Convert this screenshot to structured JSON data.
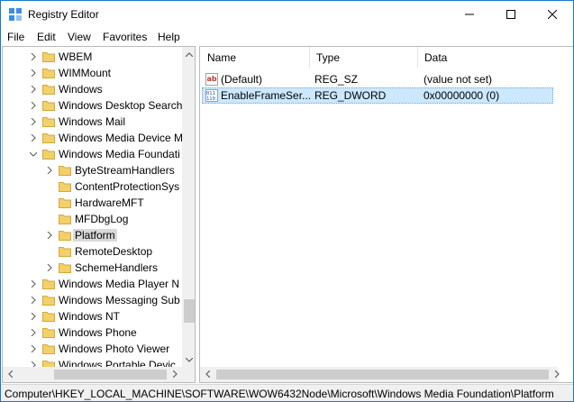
{
  "window": {
    "title": "Registry Editor",
    "colors": {
      "accent_border": "#1979ca",
      "selection_list": "#cce8ff",
      "selection_tree": "#d9d9d9",
      "folder": "#f2d06b"
    }
  },
  "menu": [
    "File",
    "Edit",
    "View",
    "Favorites",
    "Help"
  ],
  "tree": {
    "items": [
      {
        "label": "WBEM",
        "expanded": false
      },
      {
        "label": "WIMMount",
        "expanded": false
      },
      {
        "label": "Windows",
        "expanded": false
      },
      {
        "label": "Windows Desktop Search",
        "expanded": false
      },
      {
        "label": "Windows Mail",
        "expanded": false
      },
      {
        "label": "Windows Media Device M",
        "expanded": false
      },
      {
        "label": "Windows Media Foundati",
        "expanded": true
      },
      {
        "label": "ByteStreamHandlers",
        "child": true,
        "has_children": true
      },
      {
        "label": "ContentProtectionSys",
        "child": true,
        "has_children": false
      },
      {
        "label": "HardwareMFT",
        "child": true,
        "has_children": false
      },
      {
        "label": "MFDbgLog",
        "child": true,
        "has_children": false
      },
      {
        "label": "Platform",
        "child": true,
        "has_children": true,
        "selected": true
      },
      {
        "label": "RemoteDesktop",
        "child": true,
        "has_children": false
      },
      {
        "label": "SchemeHandlers",
        "child": true,
        "has_children": true
      },
      {
        "label": "Windows Media Player N",
        "expanded": false
      },
      {
        "label": "Windows Messaging Sub",
        "expanded": false
      },
      {
        "label": "Windows NT",
        "expanded": false
      },
      {
        "label": "Windows Phone",
        "expanded": false
      },
      {
        "label": "Windows Photo Viewer",
        "expanded": false
      },
      {
        "label": "Windows Portable Devic",
        "expanded": false
      }
    ]
  },
  "list": {
    "columns": [
      "Name",
      "Type",
      "Data"
    ],
    "rows": [
      {
        "icon": "string-value-icon",
        "name": "(Default)",
        "type": "REG_SZ",
        "data": "(value not set)",
        "selected": false
      },
      {
        "icon": "dword-value-icon",
        "name": "EnableFrameSer...",
        "type": "REG_DWORD",
        "data": "0x00000000 (0)",
        "selected": true
      }
    ]
  },
  "status": {
    "path": "Computer\\HKEY_LOCAL_MACHINE\\SOFTWARE\\WOW6432Node\\Microsoft\\Windows Media Foundation\\Platform"
  }
}
